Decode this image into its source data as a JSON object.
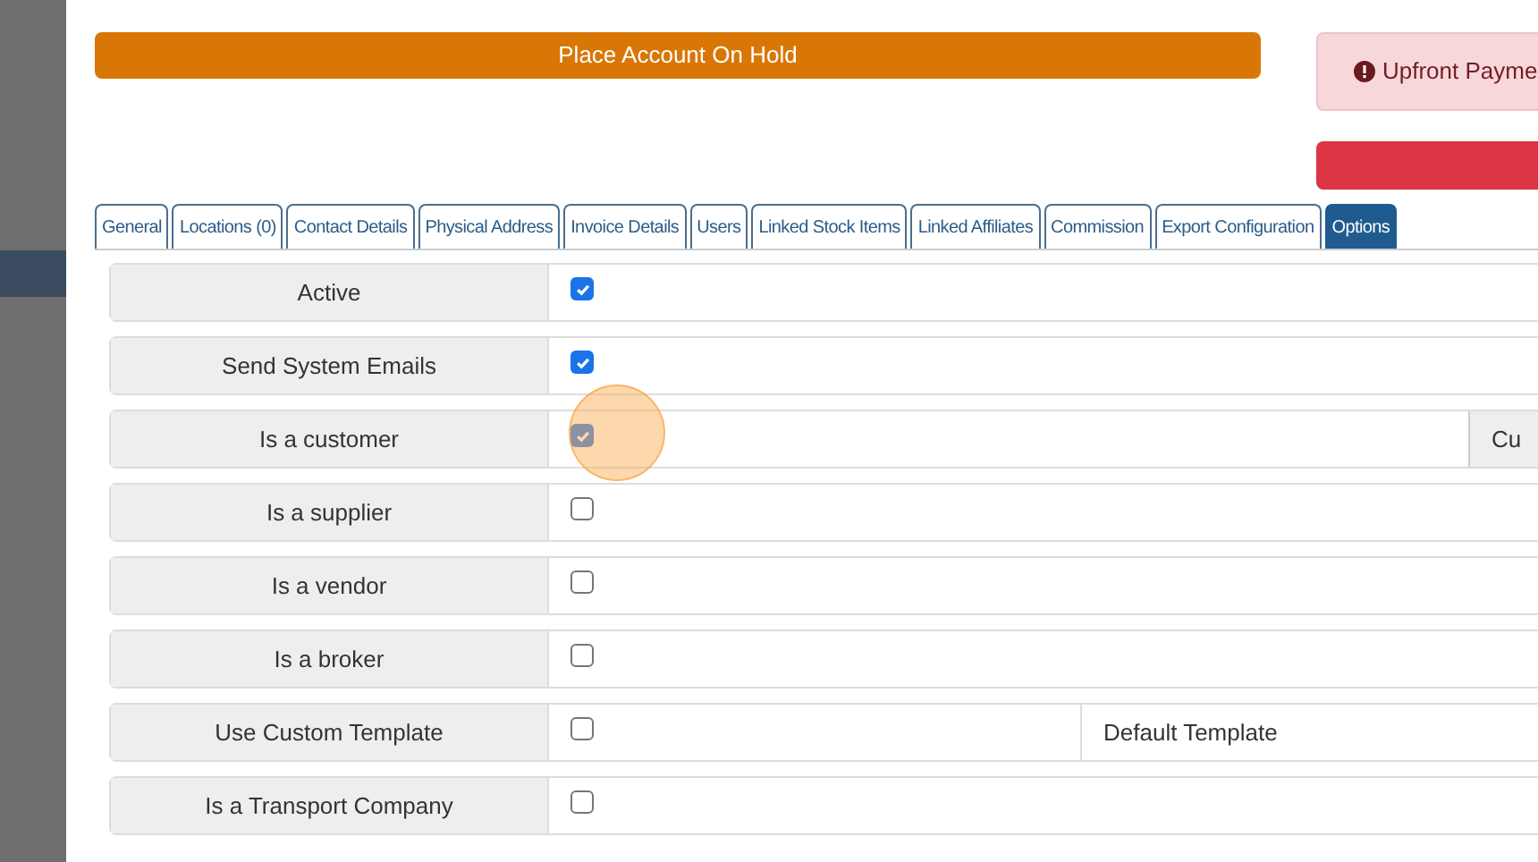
{
  "hold_button": {
    "label": "Place Account On Hold"
  },
  "alert": {
    "text": "Upfront Payme"
  },
  "tabs": [
    {
      "label": "General",
      "selected": false
    },
    {
      "label": "Locations (0)",
      "selected": false
    },
    {
      "label": "Contact Details",
      "selected": false
    },
    {
      "label": "Physical Address",
      "selected": false
    },
    {
      "label": "Invoice Details",
      "selected": false
    },
    {
      "label": "Users",
      "selected": false
    },
    {
      "label": "Linked Stock Items",
      "selected": false
    },
    {
      "label": "Linked Affiliates",
      "selected": false
    },
    {
      "label": "Commission",
      "selected": false
    },
    {
      "label": "Export Configuration",
      "selected": false
    },
    {
      "label": "Options",
      "selected": true
    }
  ],
  "options": [
    {
      "label": "Active",
      "checked": true
    },
    {
      "label": "Send System Emails",
      "checked": true
    },
    {
      "label": "Is a customer",
      "checked": true,
      "button": "Cu"
    },
    {
      "label": "Is a supplier",
      "checked": false
    },
    {
      "label": "Is a vendor",
      "checked": false
    },
    {
      "label": "Is a broker",
      "checked": false
    },
    {
      "label": "Use Custom Template",
      "checked": false,
      "template": "Default Template"
    },
    {
      "label": "Is a Transport Company",
      "checked": false
    }
  ]
}
